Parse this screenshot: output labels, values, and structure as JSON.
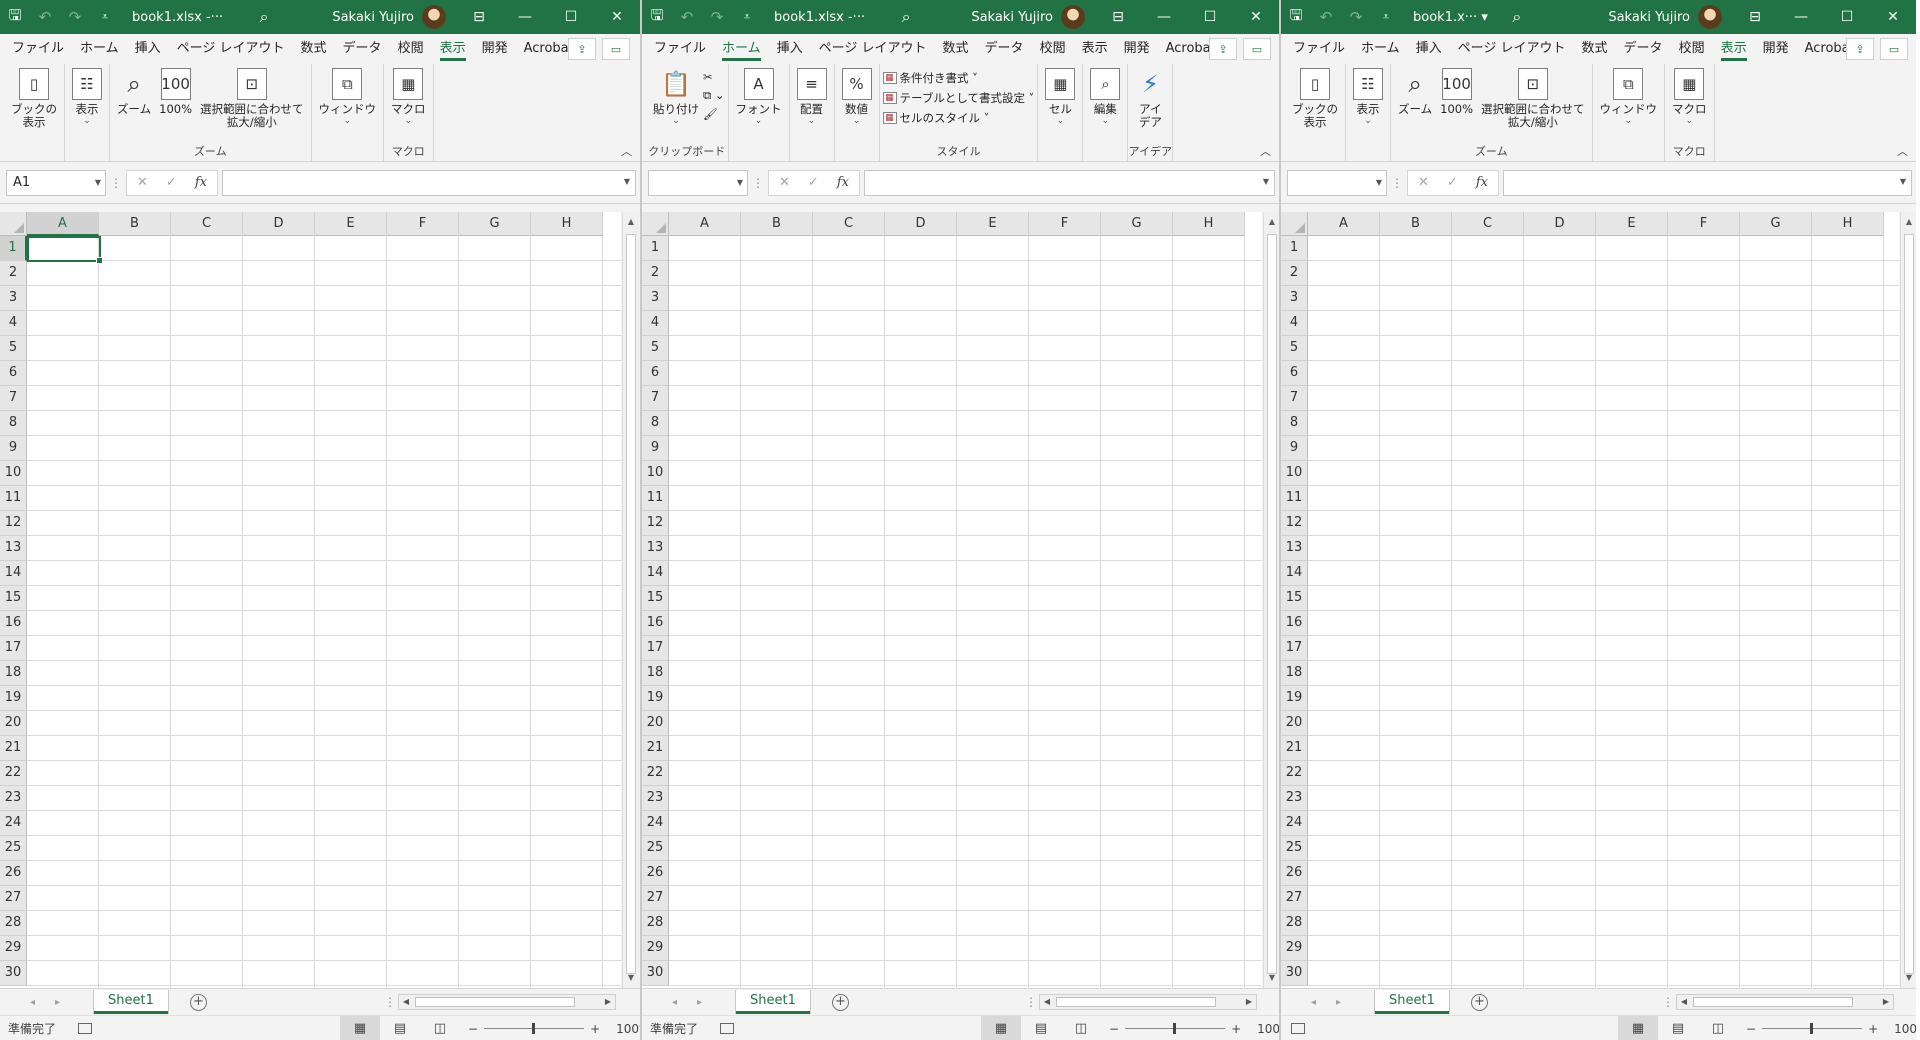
{
  "windows": [
    {
      "file_name": "book1.xlsx  -···",
      "user_name": "Sakaki Yujiro",
      "active_tab": "表示",
      "name_box": "A1",
      "ribbon": "view",
      "show_active_cell": true
    },
    {
      "file_name": "book1.xlsx  -···",
      "user_name": "Sakaki Yujiro",
      "active_tab": "ホーム",
      "name_box": "",
      "ribbon": "home",
      "show_active_cell": false
    },
    {
      "file_name": "book1.x···  ▾",
      "user_name": "Sakaki Yujiro",
      "active_tab": "表示",
      "name_box": "",
      "ribbon": "view",
      "show_active_cell": false
    }
  ],
  "menu_tabs": [
    "ファイル",
    "ホーム",
    "挿入",
    "ページ レイアウト",
    "数式",
    "データ",
    "校閲",
    "表示",
    "開発",
    "Acrobat"
  ],
  "view_ribbon": {
    "workbook_views_label": "ブックの\n表示",
    "show_label": "表示",
    "zoom_label": "ズーム",
    "zoom100_label": "100%",
    "zoom_selection_label": "選択範囲に合わせて\n拡大/縮小",
    "zoom_group_label": "ズーム",
    "window_label": "ウィンドウ",
    "macro_label": "マクロ",
    "macro_group_label": "マクロ"
  },
  "home_ribbon": {
    "paste_label": "貼り付け",
    "clipboard_group_label": "クリップボード",
    "font_label": "フォント",
    "alignment_label": "配置",
    "number_label": "数値",
    "conditional_format_label": "条件付き書式 ˅",
    "format_as_table_label": "テーブルとして書式設定 ˅",
    "cell_styles_label": "セルのスタイル ˅",
    "styles_group_label": "スタイル",
    "cells_label": "セル",
    "editing_label": "編集",
    "ideas_label": "アイ\nデア",
    "ideas_group_label": "アイデア"
  },
  "formula_bar": {
    "cancel": "✕",
    "enter": "✓",
    "fx": "fx"
  },
  "columns": [
    "A",
    "B",
    "C",
    "D",
    "E",
    "F",
    "G",
    "H"
  ],
  "rows": [
    "1",
    "2",
    "3",
    "4",
    "5",
    "6",
    "7",
    "8",
    "9",
    "10",
    "11",
    "12",
    "13",
    "14",
    "15",
    "16",
    "17",
    "18",
    "19",
    "20",
    "21",
    "22",
    "23",
    "24",
    "25",
    "26",
    "27",
    "28",
    "29",
    "30"
  ],
  "sheet_tab": "Sheet1",
  "status_text_left": "準備完了",
  "zoom_level": "100%",
  "accent_color": "#217346"
}
